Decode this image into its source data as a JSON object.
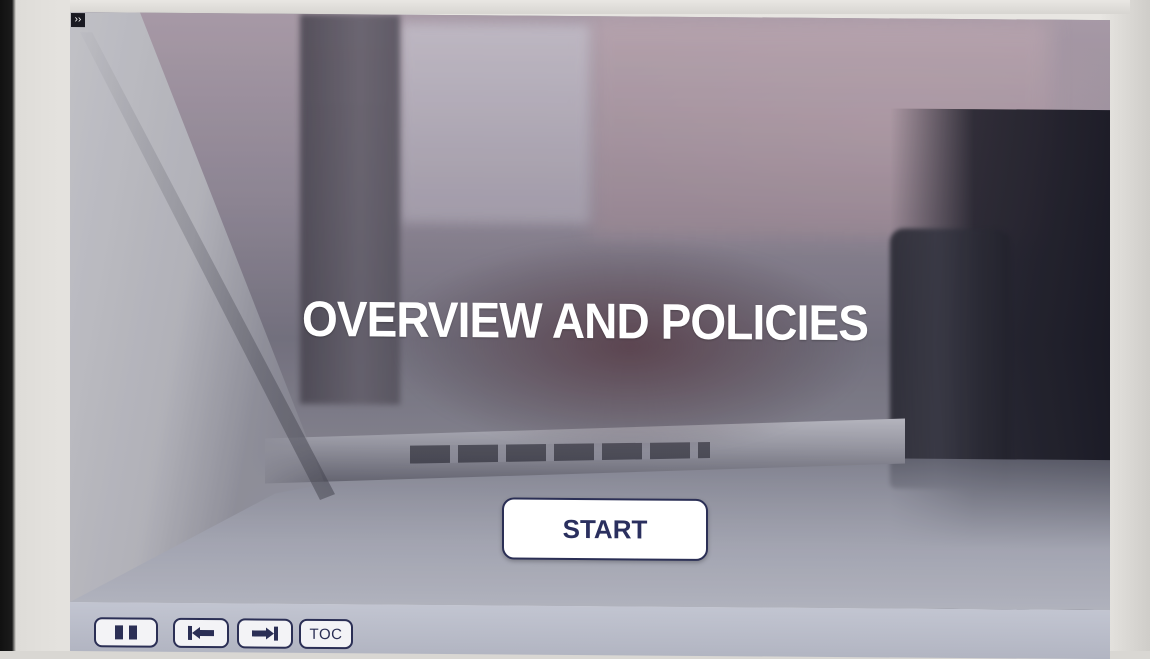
{
  "slide": {
    "title": "OVERVIEW AND POLICIES",
    "start_label": "START"
  },
  "player": {
    "menu_toggle_icon": "double-chevron-right-icon",
    "menu_toggle_glyph": "››",
    "controls": {
      "pause_icon": "pause-icon",
      "prev_icon": "skip-back-icon",
      "next_icon": "skip-forward-icon",
      "toc_label": "TOC"
    }
  },
  "colors": {
    "button_border": "#2b2f55",
    "button_text": "#2a2f5e",
    "control_bar": "#b9bcc9"
  }
}
